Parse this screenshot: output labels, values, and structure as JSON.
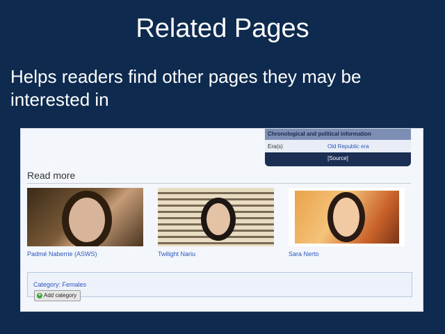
{
  "slide": {
    "title": "Related Pages",
    "body": "Helps readers find other pages they may be interested in"
  },
  "infobox": {
    "header": "Chronological and political information",
    "row_label": "Era(s)",
    "row_value": "Old Republic era",
    "source_link": "[Source]"
  },
  "read_more": {
    "heading": "Read more",
    "items": [
      {
        "caption": "Padmé Naberrie (ASWS)"
      },
      {
        "caption": "Twilight Nariu"
      },
      {
        "caption": "Sara Nerto"
      }
    ]
  },
  "categories": {
    "label": "Category: Females",
    "add_button": "Add category",
    "add_icon": "plus-circle-icon"
  }
}
